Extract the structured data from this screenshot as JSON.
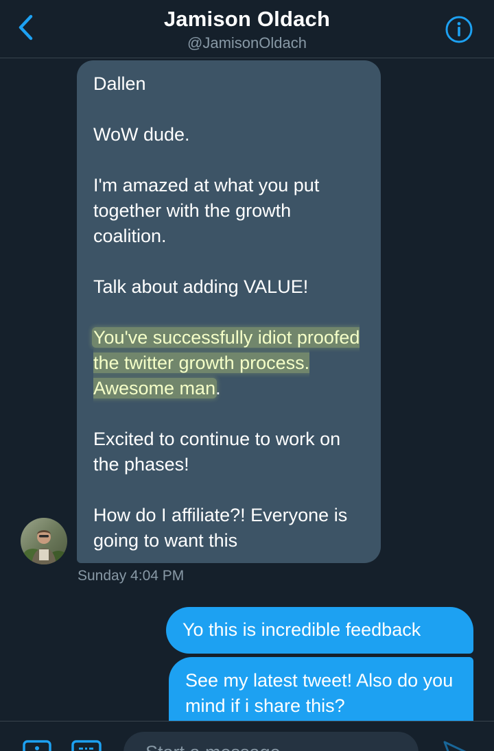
{
  "header": {
    "title": "Jamison Oldach",
    "handle": "@JamisonOldach",
    "back_icon": "chevron-left-icon",
    "info_icon": "info-circle-icon"
  },
  "incoming_message": {
    "paragraphs": {
      "p1": "Dallen",
      "p2": "WoW dude.",
      "p3": "I'm amazed at what you put together with the growth coalition.",
      "p4": "Talk about adding VALUE!",
      "p5_highlighted": "You've successfully idiot proofed the twitter growth process. Awesome man",
      "p5_tail": ".",
      "p6": "Excited to continue to work on the phases!",
      "p7": "How do I affiliate?! Everyone is going to want this"
    },
    "timestamp": "Sunday 4:04 PM"
  },
  "outgoing_messages": {
    "m1": "Yo this is incredible feedback",
    "m2": "See my latest tweet! Also do you mind if i share this?"
  },
  "composer": {
    "placeholder": "Start a message",
    "photo_icon": "image-icon",
    "gif_icon": "gif-icon",
    "send_icon": "send-icon"
  },
  "colors": {
    "background": "#15202b",
    "incoming_bubble": "#3d5466",
    "outgoing_bubble": "#1da1f2",
    "accent": "#1da1f2",
    "secondary_text": "#8899a6",
    "highlight": "#e0ee78"
  }
}
